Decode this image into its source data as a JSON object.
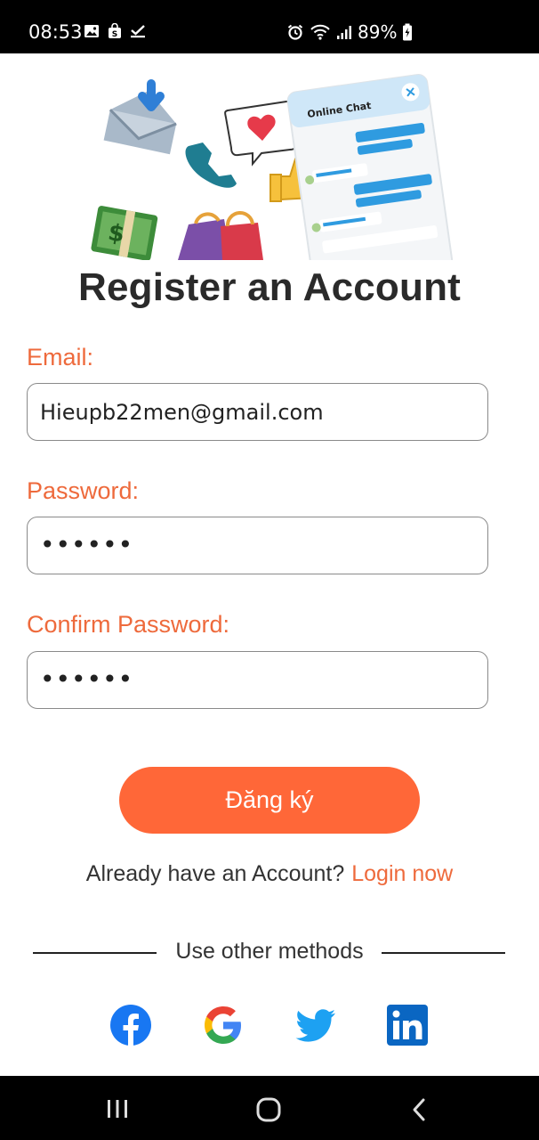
{
  "status_bar": {
    "time": "08:53",
    "battery": "89%",
    "icons": [
      "image-icon",
      "shopping-bag-icon",
      "check-icon",
      "alarm-icon",
      "wifi-icon",
      "signal-icon",
      "battery-charging-icon"
    ]
  },
  "hero": {
    "chat_widget_title": "Online Chat"
  },
  "page": {
    "title": "Register an Account"
  },
  "form": {
    "email": {
      "label": "Email:",
      "value": "Hieupb22men@gmail.com"
    },
    "password": {
      "label": "Password:",
      "value": "••••••"
    },
    "confirm_password": {
      "label": "Confirm Password:",
      "value": "••••••"
    },
    "submit_label": "Đăng ký"
  },
  "login": {
    "prompt": "Already have an Account?",
    "link": "Login now"
  },
  "other_methods": {
    "label": "Use other methods",
    "providers": [
      "facebook-icon",
      "google-icon",
      "twitter-icon",
      "linkedin-icon"
    ]
  },
  "nav": {
    "buttons": [
      "recents-icon",
      "home-icon",
      "back-icon"
    ]
  },
  "colors": {
    "accent": "#ff6738",
    "label": "#ee6a3c",
    "title": "#2a2a2a"
  }
}
